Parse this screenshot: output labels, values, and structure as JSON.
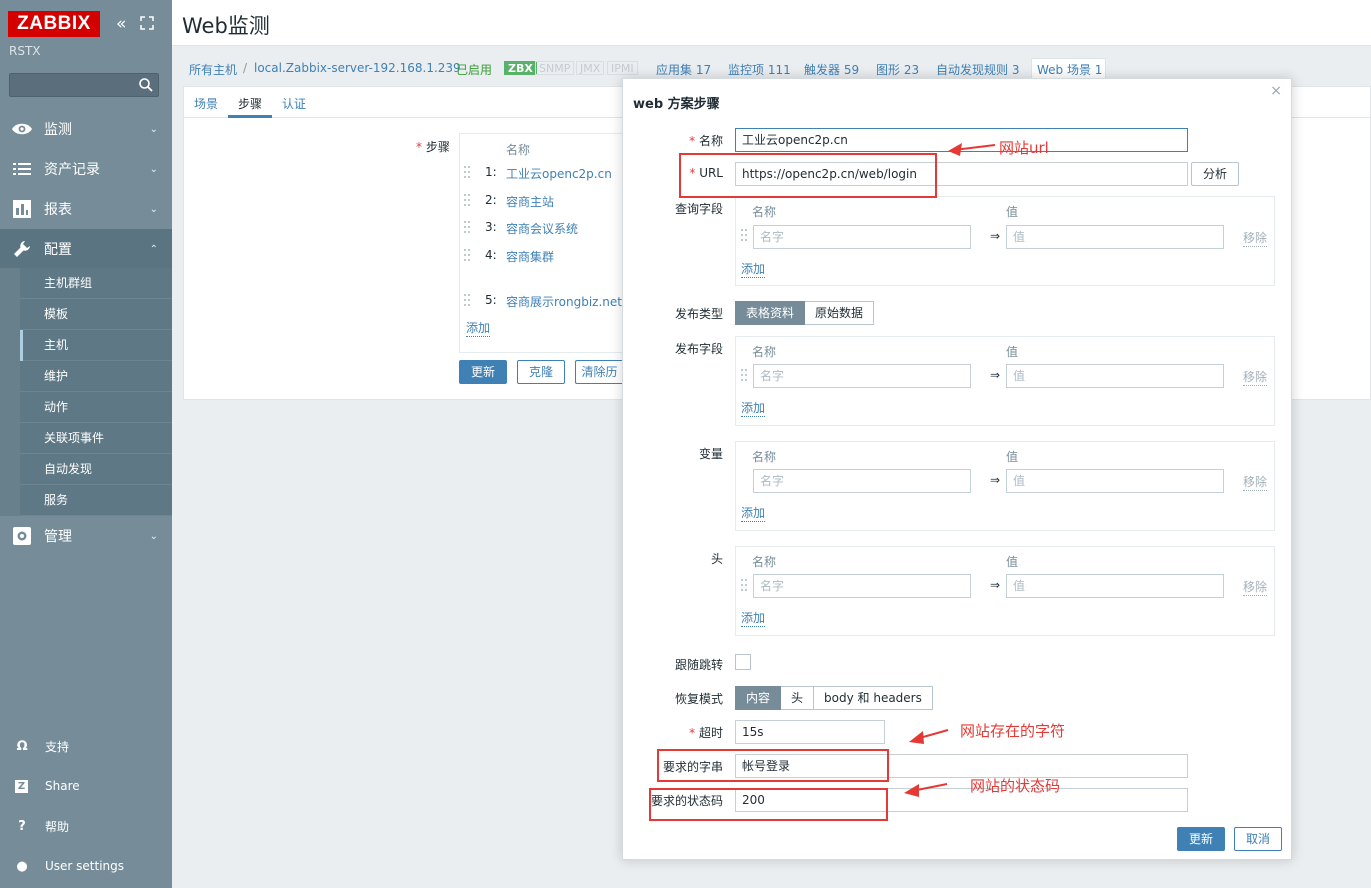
{
  "sidebar": {
    "logo": "ZABBIX",
    "server_name": "RSTX",
    "collapse_icon": "«",
    "menu": [
      {
        "label": "监测",
        "icon": "eye-icon"
      },
      {
        "label": "资产记录",
        "icon": "list-icon"
      },
      {
        "label": "报表",
        "icon": "bar-chart-icon"
      },
      {
        "label": "配置",
        "icon": "wrench-icon"
      },
      {
        "label": "管理",
        "icon": "gear-icon"
      }
    ],
    "config_submenu": [
      "主机群组",
      "模板",
      "主机",
      "维护",
      "动作",
      "关联项事件",
      "自动发现",
      "服务"
    ],
    "bottom": [
      {
        "label": "支持",
        "icon": "headset-icon",
        "glyph": "Ω"
      },
      {
        "label": "Share",
        "icon": "share-icon",
        "glyph": "Z"
      },
      {
        "label": "帮助",
        "icon": "help-icon",
        "glyph": "?"
      },
      {
        "label": "User settings",
        "icon": "user-icon",
        "glyph": "●"
      }
    ]
  },
  "header": {
    "title": "Web监测"
  },
  "nav": {
    "all_hosts": "所有主机",
    "sep": "/",
    "host": "local.Zabbix-server-192.168.1.239",
    "enabled": "已启用",
    "avail": [
      "ZBX",
      "SNMP",
      "JMX",
      "IPMI"
    ],
    "links": [
      "应用集 17",
      "监控项 111",
      "触发器 59",
      "图形 23",
      "自动发现规则 3",
      "Web 场景 1"
    ]
  },
  "tabs": [
    "场景",
    "步骤",
    "认证"
  ],
  "steps": {
    "label": "步骤",
    "column": "名称",
    "items": [
      {
        "num": "1:",
        "name": "工业云openc2p.cn"
      },
      {
        "num": "2:",
        "name": "容商主站"
      },
      {
        "num": "3:",
        "name": "容商会议系统"
      },
      {
        "num": "4:",
        "name": "容商集群"
      },
      {
        "num": "5:",
        "name": "容商展示rongbiz.net"
      }
    ],
    "add": "添加"
  },
  "buttons": {
    "update": "更新",
    "clone": "克隆",
    "clear": "清除历"
  },
  "modal": {
    "title": "web 方案步骤",
    "close": "×",
    "name_label": "名称",
    "name_value": "工业云openc2p.cn",
    "url_label": "URL",
    "url_value": "https://openc2p.cn/web/login",
    "parse_button": "分析",
    "query_label": "查询字段",
    "post_type_label": "发布类型",
    "post_type_options": [
      "表格资料",
      "原始数据"
    ],
    "post_fields_label": "发布字段",
    "variables_label": "变量",
    "headers_label": "头",
    "col_name": "名称",
    "col_value": "值",
    "ph_name": "名字",
    "ph_value": "值",
    "arrow": "⇒",
    "remove": "移除",
    "add": "添加",
    "follow_label": "跟随跳转",
    "retrieve_label": "恢复模式",
    "retrieve_options": [
      "内容",
      "头",
      "body 和 headers"
    ],
    "timeout_label": "超时",
    "timeout_value": "15s",
    "required_string_label": "要求的字串",
    "required_string_value": "帐号登录",
    "status_codes_label": "要求的状态码",
    "status_codes_value": "200",
    "update_button": "更新",
    "cancel_button": "取消"
  },
  "annotations": {
    "url": "网站url",
    "string": "网站存在的字符",
    "status": "网站的状态码",
    "color": "#e53935"
  }
}
